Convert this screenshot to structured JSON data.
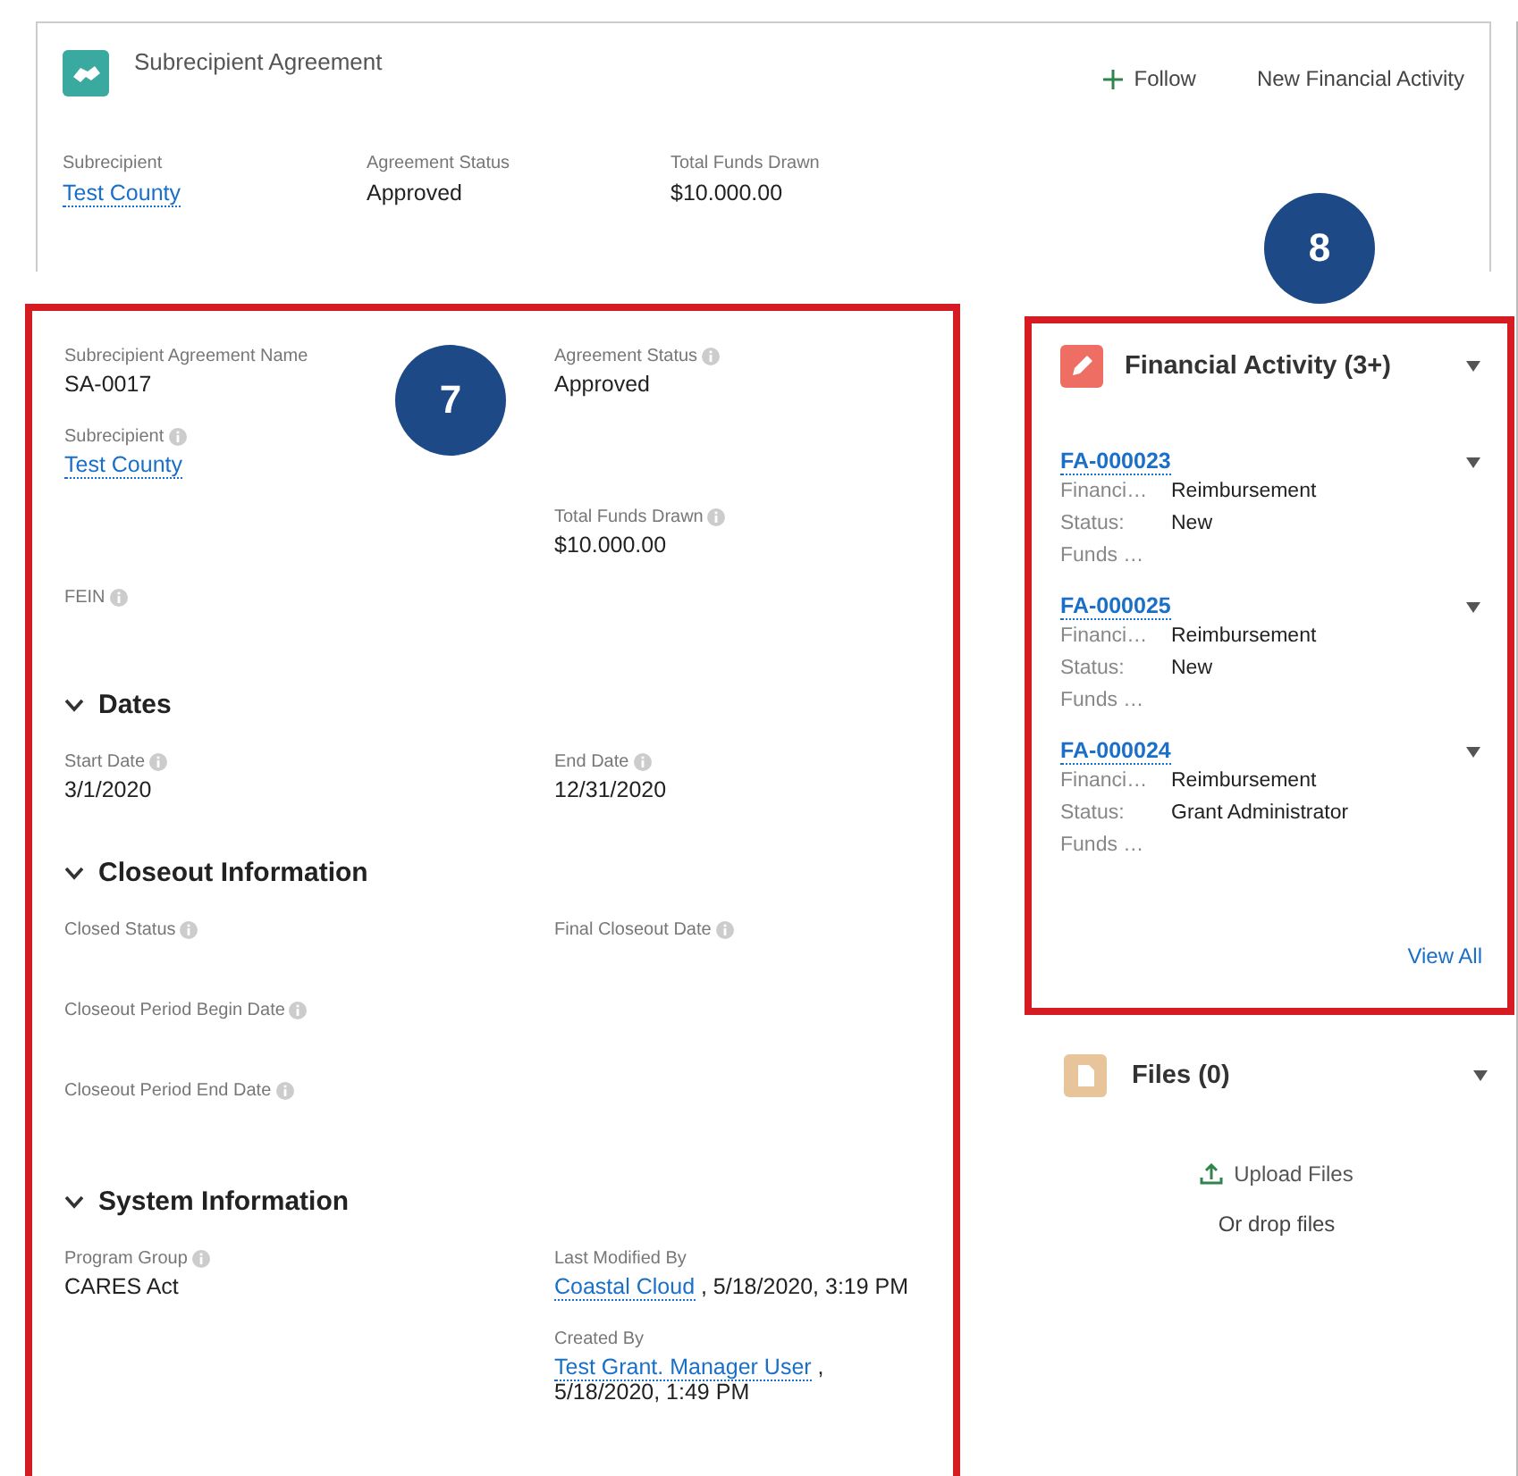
{
  "header": {
    "title": "Subrecipient Agreement",
    "actions": [
      {
        "label": "Follow",
        "kind": "follow"
      },
      {
        "label": "New Financial Activity",
        "kind": "plain"
      }
    ],
    "fields": [
      {
        "label": "Subrecipient",
        "value": "Test County",
        "link": true
      },
      {
        "label": "Agreement Status",
        "value": "Approved",
        "link": false
      },
      {
        "label": "Total Funds Drawn",
        "value": "$10.000.00",
        "link": false
      }
    ]
  },
  "callouts": [
    "7",
    "8"
  ],
  "details": {
    "rows": [
      {
        "left": {
          "label": "Subrecipient Agreement Name",
          "info": false,
          "parts": [
            {
              "text": "SA-0017",
              "link": false
            }
          ]
        },
        "right": {
          "label": "Agreement Status",
          "info": true,
          "parts": [
            {
              "text": "Approved",
              "link": false
            }
          ]
        }
      },
      {
        "left": {
          "label": "Subrecipient",
          "info": true,
          "parts": [
            {
              "text": "Test County",
              "link": true
            }
          ]
        }
      },
      {
        "right": {
          "label": "Total Funds Drawn",
          "info": true,
          "parts": [
            {
              "text": "$10.000.00",
              "link": false
            }
          ]
        }
      },
      {
        "left": {
          "label": "FEIN",
          "info": true
        }
      }
    ],
    "sections": [
      {
        "title": "Dates",
        "expanded": true,
        "rows": [
          {
            "left": {
              "label": "Start Date",
              "info": true,
              "parts": [
                {
                  "text": "3/1/2020",
                  "link": false
                }
              ]
            },
            "right": {
              "label": "End Date",
              "info": true,
              "parts": [
                {
                  "text": "12/31/2020",
                  "link": false
                }
              ]
            }
          }
        ]
      },
      {
        "title": "Closeout Information",
        "expanded": true,
        "rows": [
          {
            "left": {
              "label": "Closed Status",
              "info": true
            },
            "right": {
              "label": "Final Closeout Date",
              "info": true
            }
          },
          {
            "left": {
              "label": "Closeout Period Begin Date",
              "info": true
            }
          },
          {
            "left": {
              "label": "Closeout Period End Date",
              "info": true
            }
          }
        ]
      },
      {
        "title": "System Information",
        "expanded": true,
        "rows": [
          {
            "left": {
              "label": "Program Group",
              "info": true,
              "parts": [
                {
                  "text": "CARES Act",
                  "link": false
                }
              ]
            },
            "right": {
              "label": "Last Modified By",
              "info": false,
              "parts": [
                {
                  "text": "Coastal Cloud",
                  "link": true
                },
                {
                  "text": " , 5/18/2020, 3:19 PM",
                  "link": false
                }
              ]
            }
          },
          {
            "right": {
              "label": "Created By",
              "info": false,
              "parts": [
                {
                  "text": "Test Grant. Manager User",
                  "link": true
                },
                {
                  "text": " ,",
                  "link": false
                },
                {
                  "text": "5/18/2020, 1:49 PM",
                  "link": false,
                  "newline": true
                }
              ]
            }
          }
        ]
      }
    ]
  },
  "financial_activity": {
    "title": "Financial Activity (3+)",
    "items": [
      {
        "id": "FA-000023",
        "fields": [
          {
            "label": "Financi…",
            "value": "Reimbursement"
          },
          {
            "label": "Status:",
            "value": "New"
          },
          {
            "label": "Funds …"
          }
        ]
      },
      {
        "id": "FA-000025",
        "fields": [
          {
            "label": "Financi…",
            "value": "Reimbursement"
          },
          {
            "label": "Status:",
            "value": "New"
          },
          {
            "label": "Funds …"
          }
        ]
      },
      {
        "id": "FA-000024",
        "fields": [
          {
            "label": "Financi…",
            "value": "Reimbursement"
          },
          {
            "label": "Status:",
            "value": "Grant Administrator"
          },
          {
            "label": "Funds …"
          }
        ]
      }
    ],
    "view_all": "View All"
  },
  "files": {
    "title": "Files (0)",
    "upload": "Upload Files",
    "drop": "Or drop files"
  }
}
